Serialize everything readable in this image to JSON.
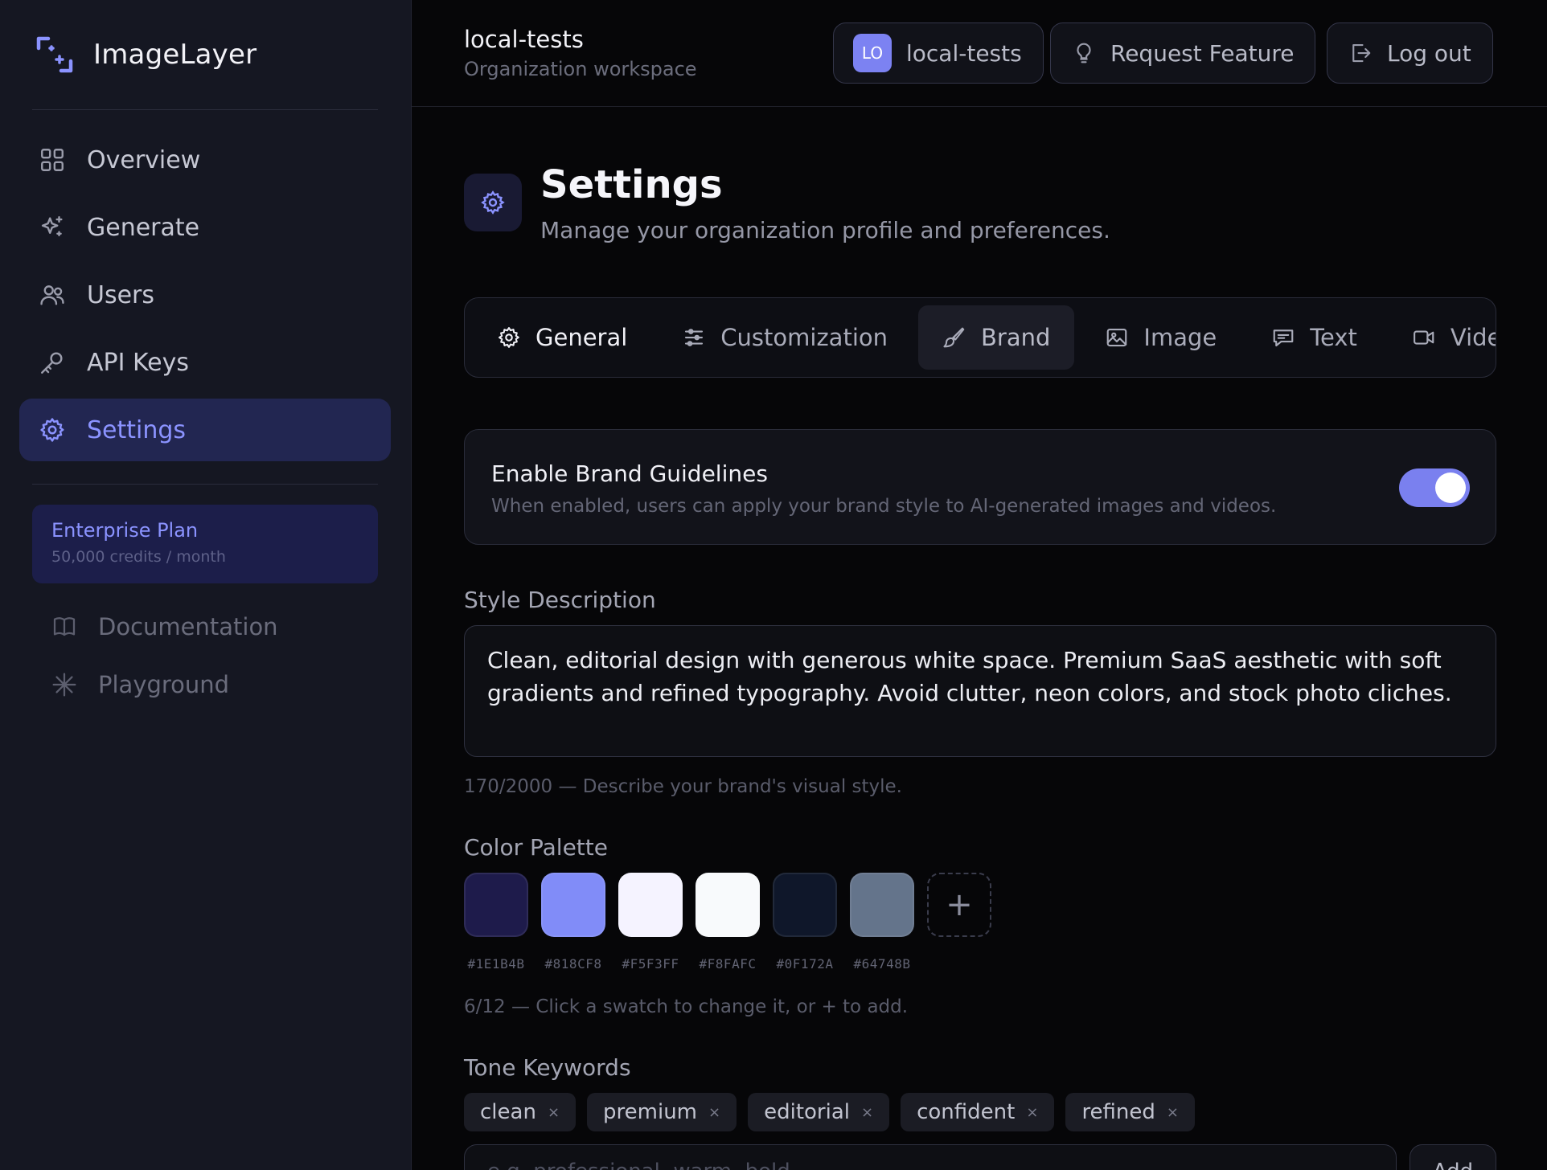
{
  "sidebar": {
    "brand_name": "ImageLayer",
    "nav": [
      {
        "label": "Overview",
        "icon": "grid-icon"
      },
      {
        "label": "Generate",
        "icon": "sparkles-icon"
      },
      {
        "label": "Users",
        "icon": "users-icon"
      },
      {
        "label": "API Keys",
        "icon": "key-icon"
      },
      {
        "label": "Settings",
        "icon": "gear-icon",
        "active": true
      }
    ],
    "plan": {
      "title": "Enterprise Plan",
      "subtitle": "50,000 credits / month"
    },
    "links": [
      {
        "label": "Documentation",
        "icon": "book-icon"
      },
      {
        "label": "Playground",
        "icon": "asterisk-icon"
      }
    ]
  },
  "header": {
    "workspace_name": "local-tests",
    "workspace_sub": "Organization workspace",
    "org_avatar": "LO",
    "org_label": "local-tests",
    "request_feature": "Request Feature",
    "logout": "Log out"
  },
  "page": {
    "title": "Settings",
    "subtitle": "Manage your organization profile and preferences."
  },
  "tabs": [
    {
      "label": "General",
      "icon": "gear-icon"
    },
    {
      "label": "Customization",
      "icon": "sliders-icon"
    },
    {
      "label": "Brand",
      "icon": "brush-icon",
      "active": true
    },
    {
      "label": "Image",
      "icon": "image-icon"
    },
    {
      "label": "Text",
      "icon": "message-icon"
    },
    {
      "label": "Video",
      "icon": "video-icon"
    }
  ],
  "brand_guidelines": {
    "title": "Enable Brand Guidelines",
    "description": "When enabled, users can apply your brand style to AI-generated images and videos.",
    "enabled": true
  },
  "style": {
    "label": "Style Description",
    "value": "Clean, editorial design with generous white space. Premium SaaS aesthetic with soft gradients and refined typography. Avoid clutter, neon colors, and stock photo cliches.",
    "hint": "170/2000 — Describe your brand's visual style."
  },
  "palette": {
    "label": "Color Palette",
    "colors": [
      "#1E1B4B",
      "#818CF8",
      "#F5F3FF",
      "#F8FAFC",
      "#0F172A",
      "#64748B"
    ],
    "add_symbol": "+",
    "hint": "6/12 — Click a swatch to change it, or + to add."
  },
  "tone": {
    "label": "Tone Keywords",
    "keywords": [
      "clean",
      "premium",
      "editorial",
      "confident",
      "refined"
    ],
    "remove_symbol": "×",
    "input_placeholder": "e.g. professional, warm, bold",
    "add_label": "Add"
  },
  "colors": {
    "accent": "#818CF8",
    "sidebar_bg": "#151722",
    "page_bg": "#060608"
  }
}
